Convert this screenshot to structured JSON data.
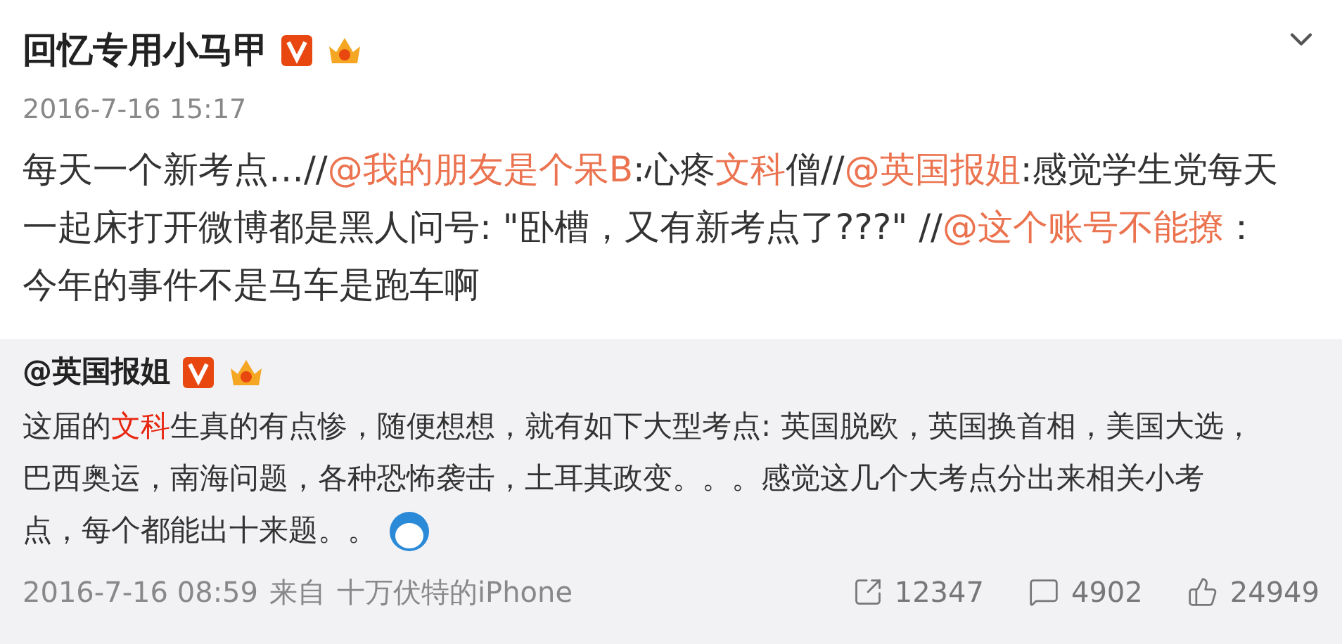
{
  "post": {
    "author": "回忆专用小马甲",
    "verified": true,
    "crown": true,
    "time": "2016-7-16 15:17",
    "lines": [
      [
        {
          "kind": "text",
          "text": "每天一个新考点…//"
        },
        {
          "kind": "mention",
          "text": "@我的朋友是个呆B"
        },
        {
          "kind": "text",
          "text": ":心疼"
        },
        {
          "kind": "keyword",
          "text": "文科"
        },
        {
          "kind": "text",
          "text": "僧//"
        },
        {
          "kind": "mention",
          "text": "@英国报姐"
        },
        {
          "kind": "text",
          "text": ":感觉学生党每天"
        }
      ],
      [
        {
          "kind": "text",
          "text": "一起床打开微博都是黑人问号: \"卧槽，又有新考点了???\" //"
        },
        {
          "kind": "mention",
          "text": "@这个账号不能撩"
        },
        {
          "kind": "text",
          "text": "："
        }
      ],
      [
        {
          "kind": "text",
          "text": "今年的事件不是马车是跑车啊"
        }
      ]
    ]
  },
  "repost": {
    "author": "@英国报姐",
    "verified": true,
    "crown": true,
    "lines": [
      [
        {
          "kind": "text",
          "text": "这届的"
        },
        {
          "kind": "keyword",
          "text": "文科"
        },
        {
          "kind": "text",
          "text": "生真的有点惨，随便想想，就有如下大型考点: 英国脱欧，英国换首相，美国大选，"
        }
      ],
      [
        {
          "kind": "text",
          "text": "巴西奥运，南海问题，各种恐怖袭击，土耳其政变。。。感觉这几个大考点分出来相关小考"
        }
      ],
      [
        {
          "kind": "text",
          "text": "点，每个都能出十来题。。"
        },
        {
          "kind": "emoji"
        }
      ]
    ],
    "time": "2016-7-16 08:59",
    "source_prefix": "来自",
    "source": "十万伏特的iPhone",
    "stats": [
      {
        "kind": "share",
        "count": "12347"
      },
      {
        "kind": "comment",
        "count": "4902"
      },
      {
        "kind": "like",
        "count": "24949"
      }
    ]
  }
}
